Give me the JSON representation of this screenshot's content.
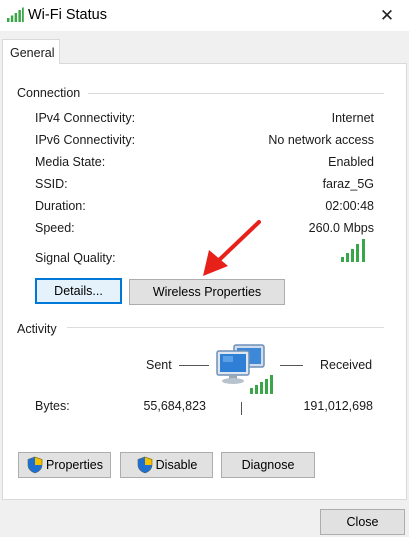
{
  "window": {
    "title": "Wi-Fi Status",
    "close_glyph": "✕"
  },
  "tabs": [
    {
      "label": "General"
    }
  ],
  "connection": {
    "group_label": "Connection",
    "rows": [
      {
        "label": "IPv4 Connectivity:",
        "value": "Internet"
      },
      {
        "label": "IPv6 Connectivity:",
        "value": "No network access"
      },
      {
        "label": "Media State:",
        "value": "Enabled"
      },
      {
        "label": "SSID:",
        "value": "faraz_5G"
      },
      {
        "label": "Duration:",
        "value": "02:00:48"
      },
      {
        "label": "Speed:",
        "value": "260.0 Mbps"
      }
    ],
    "signal_label": "Signal Quality:",
    "signal_bars_active": 5,
    "signal_bars_total": 5
  },
  "buttons": {
    "details": "Details...",
    "wireless_properties": "Wireless Properties",
    "properties": "Properties",
    "disable": "Disable",
    "diagnose": "Diagnose",
    "close": "Close"
  },
  "activity": {
    "group_label": "Activity",
    "sent_label": "Sent",
    "received_label": "Received",
    "bytes_label": "Bytes:",
    "bytes_sent": "55,684,823",
    "bytes_received": "191,012,698"
  },
  "colors": {
    "signal_green": "#3aa64a",
    "annotation_arrow": "#e8201a",
    "focus_blue": "#0078d7"
  },
  "icons": {
    "title": "wifi-signal-icon",
    "network": "network-computers-icon",
    "shield": "uac-shield-icon"
  }
}
